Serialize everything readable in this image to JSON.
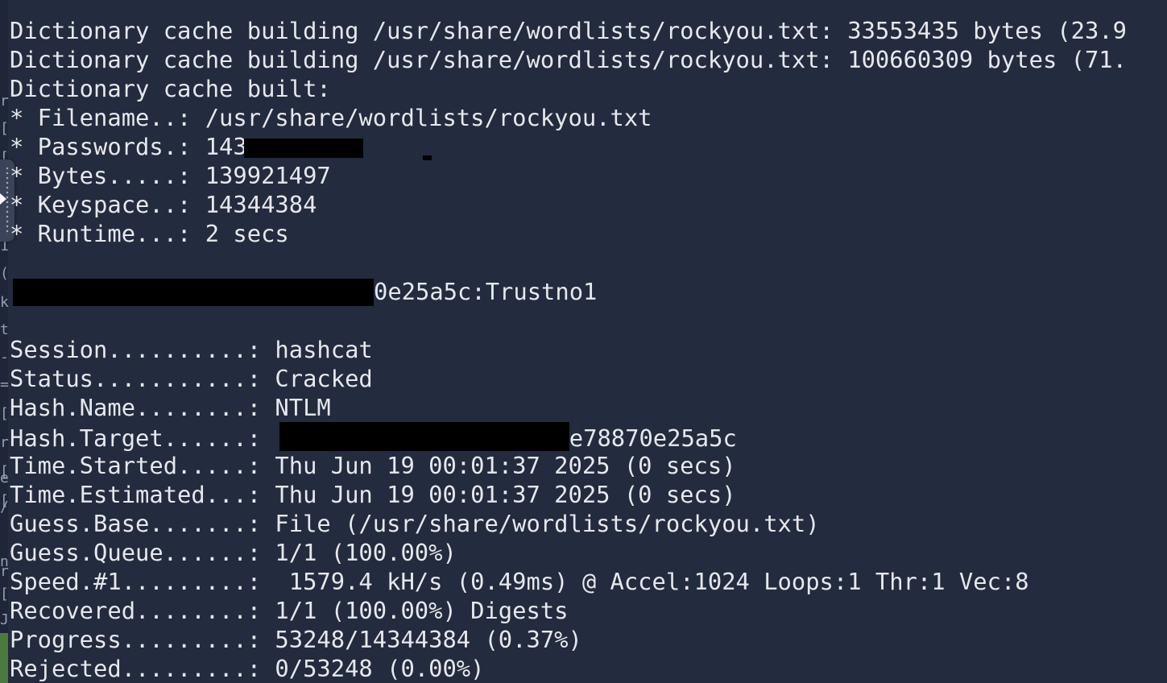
{
  "terminal": {
    "lines": [
      "Dictionary cache building /usr/share/wordlists/rockyou.txt: 33553435 bytes (23.9",
      "Dictionary cache building /usr/share/wordlists/rockyou.txt: 100660309 bytes (71.",
      "Dictionary cache built:",
      "* Filename..: /usr/share/wordlists/rockyou.txt",
      "* Passwords.: 143",
      "* Bytes.....: 139921497",
      "* Keyspace..: 14344384",
      "* Runtime...: 2 secs",
      "",
      "0e25a5c:Trustno1",
      "",
      "Session..........: hashcat",
      "Status...........: Cracked",
      "Hash.Name........: NTLM",
      "Hash.Target......: ",
      "Time.Started.....: Thu Jun 19 00:01:37 2025 (0 secs)",
      "Time.Estimated...: Thu Jun 19 00:01:37 2025 (0 secs)",
      "Guess.Base.......: File (/usr/share/wordlists/rockyou.txt)",
      "Guess.Queue......: 1/1 (100.00%)",
      "Speed.#1.........:  1579.4 kH/s (0.49ms) @ Accel:1024 Loops:1 Thr:1 Vec:8",
      "Recovered........: 1/1 (100.00%) Digests",
      "Progress.........: 53248/14344384 (0.37%)",
      "Rejected.........: 0/53248 (0.00%)"
    ],
    "hash_target_prefix": "(",
    "hash_target_suffix": "e78870e25a5c"
  },
  "left_strip": {
    "chars": [
      "r",
      "[",
      "[",
      "1",
      "(",
      "k",
      "t",
      "-",
      "=",
      "[",
      "r",
      "[",
      "[",
      "e",
      "/",
      "n",
      "r",
      "[",
      "J"
    ]
  },
  "colors": {
    "background": "#232b3e",
    "foreground": "#e6e8ec",
    "redaction": "#000000"
  }
}
